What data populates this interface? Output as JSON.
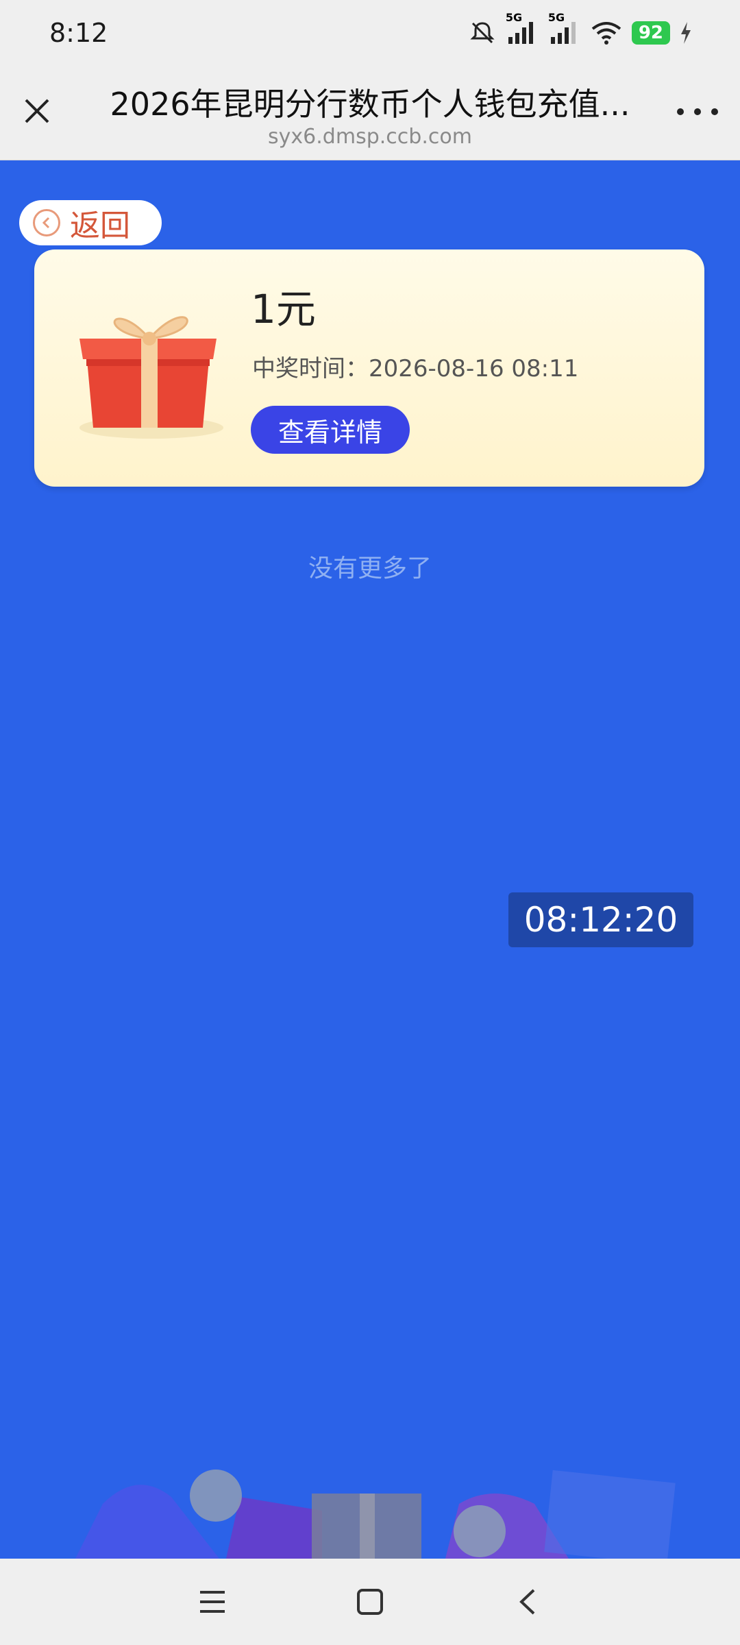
{
  "status_bar": {
    "time": "8:12",
    "signal_label_1": "5G",
    "signal_label_2": "5G",
    "battery": "92",
    "icons": [
      "mute-icon",
      "signal-icon",
      "signal-icon",
      "wifi-icon",
      "battery-icon",
      "charging-icon"
    ]
  },
  "browser": {
    "title": "2026年昆明分行数币个人钱包充值...",
    "url": "syx6.dmsp.ccb.com"
  },
  "back": {
    "label": "返回"
  },
  "prize": {
    "amount": "1元",
    "time_label": "中奖时间：2026-08-16 08:11",
    "detail_button": "查看详情"
  },
  "footer_note": "没有更多了",
  "timer": "08:12:20",
  "colors": {
    "page_bg": "#2b62e8",
    "card_bg": "#fff6d8",
    "button_bg": "#3a44e6",
    "timer_bg": "#1f47a8",
    "back_text": "#d4573a"
  }
}
